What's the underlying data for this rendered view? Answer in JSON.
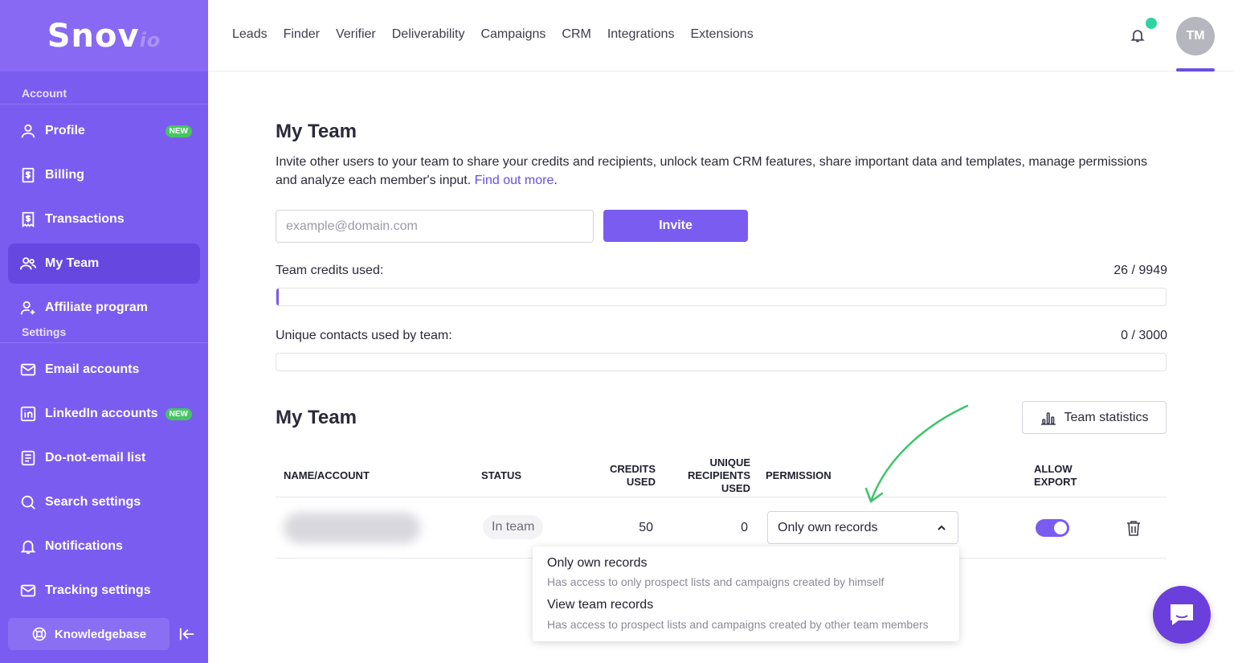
{
  "brand": {
    "name": "Snov",
    "suffix": "io"
  },
  "sidebar": {
    "account_label": "Account",
    "settings_label": "Settings",
    "account_items": [
      {
        "label": "Profile",
        "icon": "user-icon",
        "badge": "NEW"
      },
      {
        "label": "Billing",
        "icon": "billing-icon"
      },
      {
        "label": "Transactions",
        "icon": "receipt-icon"
      },
      {
        "label": "My Team",
        "icon": "team-icon",
        "active": true
      },
      {
        "label": "Affiliate program",
        "icon": "user-plus-icon"
      }
    ],
    "settings_items": [
      {
        "label": "Email accounts",
        "icon": "envelope-icon"
      },
      {
        "label": "LinkedIn accounts",
        "icon": "linkedin-icon",
        "badge": "NEW"
      },
      {
        "label": "Do-not-email list",
        "icon": "list-icon"
      },
      {
        "label": "Search settings",
        "icon": "search-icon"
      },
      {
        "label": "Notifications",
        "icon": "bell-icon"
      },
      {
        "label": "Tracking settings",
        "icon": "tracking-icon"
      }
    ],
    "knowledgebase_label": "Knowledgebase"
  },
  "topnav": {
    "items": [
      "Leads",
      "Finder",
      "Verifier",
      "Deliverability",
      "Campaigns",
      "CRM",
      "Integrations",
      "Extensions"
    ],
    "avatar_initials": "TM"
  },
  "main": {
    "title": "My Team",
    "description": "Invite other users to your team to share your credits and recipients, unlock team CRM features, share important data and templates, manage permissions and analyze each member's input.",
    "find_out_more": "Find out more",
    "email_placeholder": "example@domain.com",
    "invite_label": "Invite",
    "credits_label": "Team credits used:",
    "credits_value": "26 / 9949",
    "credits_fraction": 0.0026,
    "contacts_label": "Unique contacts used by team:",
    "contacts_value": "0 / 3000",
    "contacts_fraction": 0,
    "team_title": "My Team",
    "team_stats_label": "Team statistics"
  },
  "table": {
    "headers": {
      "name": "NAME/ACCOUNT",
      "status": "STATUS",
      "credits_1": "CREDITS",
      "credits_2": "USED",
      "unique_1": "UNIQUE",
      "unique_2": "RECIPIENTS",
      "unique_3": "USED",
      "permission": "PERMISSION",
      "export_1": "ALLOW",
      "export_2": "EXPORT"
    },
    "row": {
      "status": "In team",
      "credits_used": "50",
      "unique_used": "0",
      "permission": "Only own records",
      "allow_export": true
    },
    "permission_options": [
      {
        "title": "Only own records",
        "desc": "Has access to only prospect lists and campaigns created by himself"
      },
      {
        "title": "View team records",
        "desc": "Has access to prospect lists and campaigns created by other team members"
      }
    ]
  },
  "colors": {
    "accent": "#7b5cf0",
    "sidebar": "#7b5cf0",
    "badge": "#45c463",
    "arrow": "#3cc46a",
    "chat": "#6a3fdc"
  }
}
